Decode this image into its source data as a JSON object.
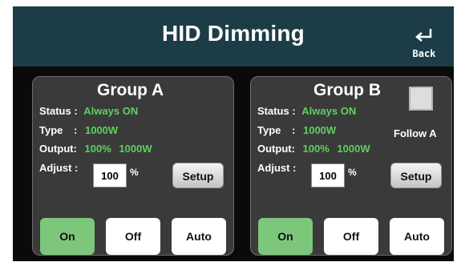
{
  "header": {
    "title": "HID Dimming",
    "back_label": "Back"
  },
  "groups": [
    {
      "title": "Group A",
      "status_label": "Status :",
      "status_value": "Always ON",
      "type_label": "Type",
      "type_colon": ":",
      "type_value": "1000W",
      "output_label": "Output:",
      "output_percent": "100%",
      "output_watts": "1000W",
      "adjust_label": "Adjust :",
      "adjust_value": "100",
      "adjust_unit": "%",
      "setup_label": "Setup",
      "buttons": {
        "on": "On",
        "off": "Off",
        "auto": "Auto",
        "active": "on"
      }
    },
    {
      "title": "Group B",
      "status_label": "Status :",
      "status_value": "Always ON",
      "type_label": "Type",
      "type_colon": ":",
      "type_value": "1000W",
      "output_label": "Output:",
      "output_percent": "100%",
      "output_watts": "1000W",
      "adjust_label": "Adjust :",
      "adjust_value": "100",
      "adjust_unit": "%",
      "setup_label": "Setup",
      "follow_label": "Follow A",
      "follow_checked": false,
      "buttons": {
        "on": "On",
        "off": "Off",
        "auto": "Auto",
        "active": "on"
      }
    }
  ],
  "colors": {
    "header_bg": "#1c3d47",
    "panel_bg": "#3a3a3a",
    "value_green": "#5ed15e",
    "active_button": "#7cc77b"
  }
}
